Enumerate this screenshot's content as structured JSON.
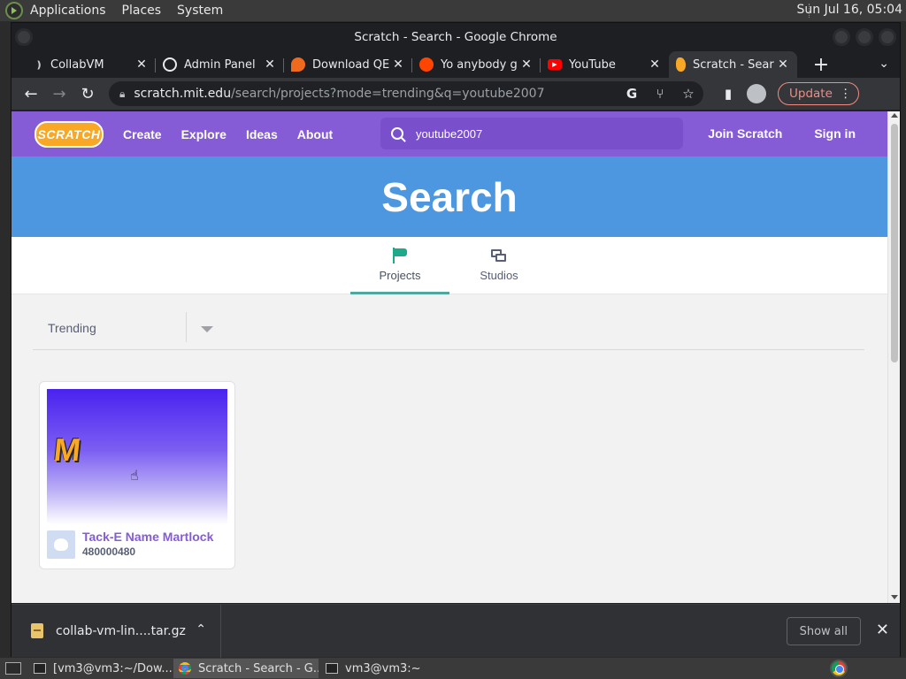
{
  "panel": {
    "menus": [
      "Applications",
      "Places",
      "System"
    ],
    "clock": "Sun Jul 16, 05:04"
  },
  "window": {
    "title": "Scratch - Search - Google Chrome"
  },
  "tabs": [
    {
      "title": "CollabVM",
      "favicon": "collabvm-icon"
    },
    {
      "title": "Admin Panel",
      "favicon": "globe-icon"
    },
    {
      "title": "Download QE",
      "favicon": "qemu-icon"
    },
    {
      "title": "Yo anybody g",
      "favicon": "reddit-icon"
    },
    {
      "title": "YouTube",
      "favicon": "youtube-icon"
    },
    {
      "title": "Scratch - Sear",
      "favicon": "scratch-icon",
      "active": true
    }
  ],
  "toolbar": {
    "url_host": "scratch.mit.edu",
    "url_path": "/search/projects?mode=trending&q=youtube2007",
    "update_label": "Update"
  },
  "scratch": {
    "logo": "SCRATCH",
    "nav": {
      "create": "Create",
      "explore": "Explore",
      "ideas": "Ideas",
      "about": "About",
      "join": "Join Scratch",
      "signin": "Sign in"
    },
    "search_value": "youtube2007",
    "banner": "Search",
    "tabs": {
      "projects": "Projects",
      "studios": "Studios"
    },
    "sort_label": "Trending",
    "project": {
      "thumb_letter": "M",
      "title": "Tack-E Name Martlock",
      "owner": "480000480"
    }
  },
  "downloads": {
    "file": "collab-vm-lin....tar.gz",
    "show_all": "Show all"
  },
  "taskbar": {
    "items": [
      "[vm3@vm3:~/Dow...",
      "Scratch - Search - G...",
      "vm3@vm3:~"
    ]
  },
  "colors": {
    "scratch_purple": "#855cd6",
    "banner_blue": "#4c97e0",
    "active_tab_underline": "#4fa89e",
    "update_red": "#f28b82"
  }
}
